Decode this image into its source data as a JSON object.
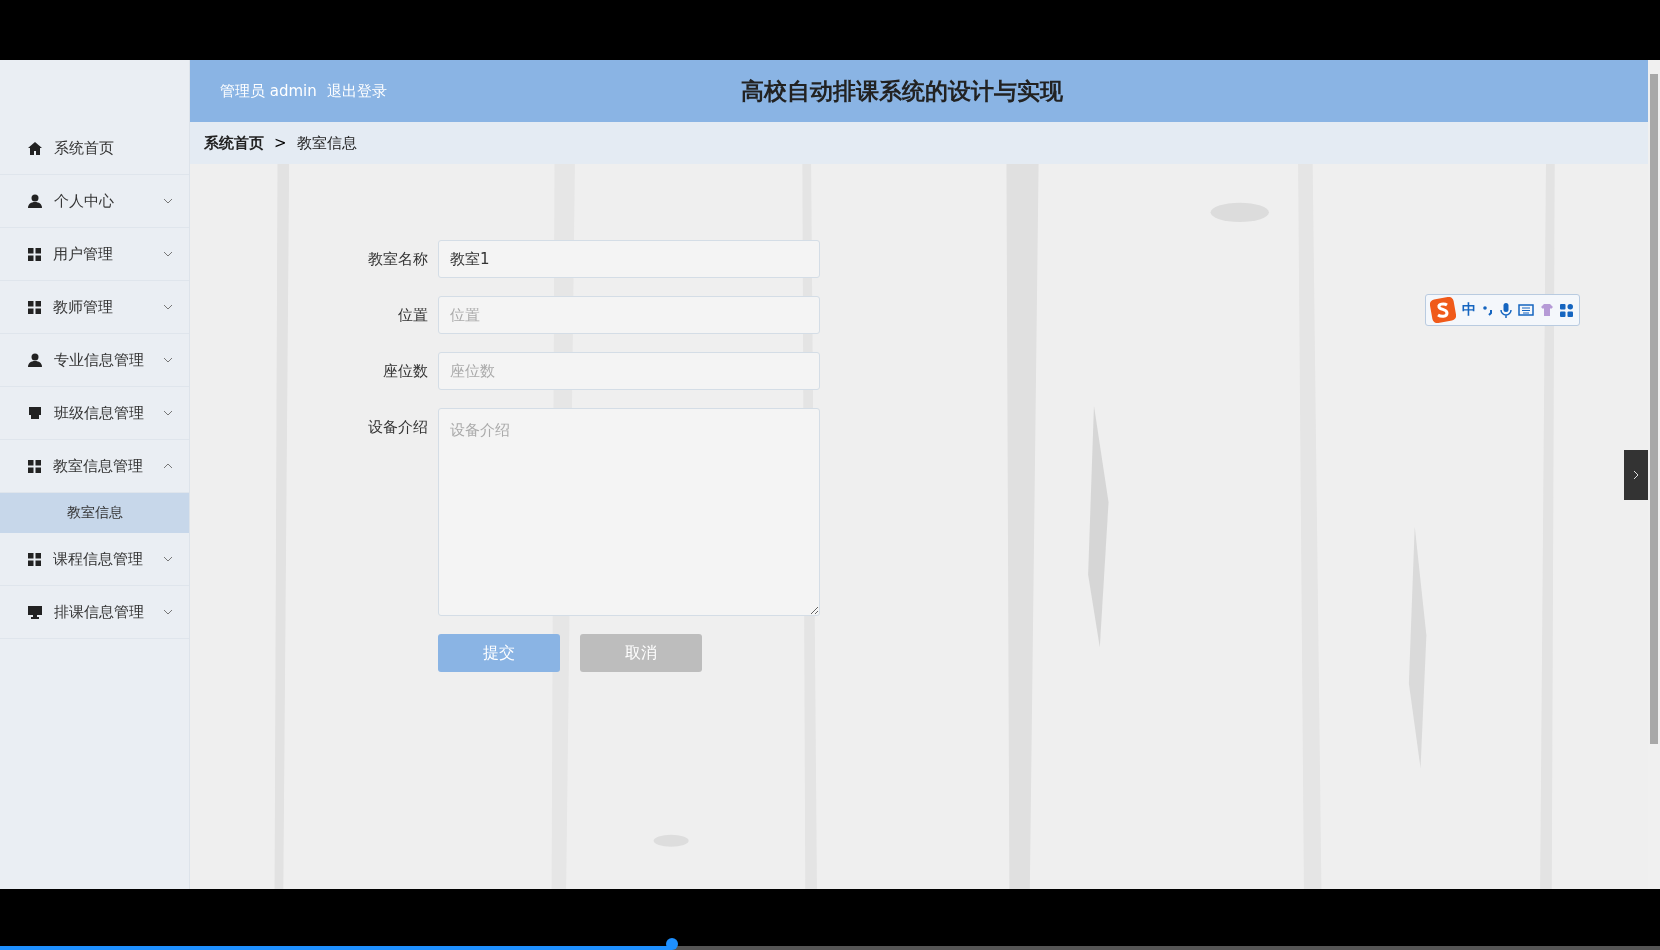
{
  "header": {
    "user_role": "管理员",
    "user_name": "admin",
    "logout": "退出登录",
    "title": "高校自动排课系统的设计与实现"
  },
  "sidebar": {
    "items": [
      {
        "label": "系统首页",
        "kind": "link"
      },
      {
        "label": "个人中心",
        "kind": "menu",
        "expanded": false
      },
      {
        "label": "用户管理",
        "kind": "menu",
        "expanded": false
      },
      {
        "label": "教师管理",
        "kind": "menu",
        "expanded": false
      },
      {
        "label": "专业信息管理",
        "kind": "menu",
        "expanded": false
      },
      {
        "label": "班级信息管理",
        "kind": "menu",
        "expanded": false
      },
      {
        "label": "教室信息管理",
        "kind": "menu",
        "expanded": true,
        "children": [
          {
            "label": "教室信息",
            "selected": true
          }
        ]
      },
      {
        "label": "课程信息管理",
        "kind": "menu",
        "expanded": false
      },
      {
        "label": "排课信息管理",
        "kind": "menu",
        "expanded": false
      }
    ]
  },
  "breadcrumb": [
    {
      "label": "系统首页",
      "current": false
    },
    {
      "label": "教室信息",
      "current": true
    }
  ],
  "breadcrumb_separator": ">",
  "form": {
    "fields": [
      {
        "label": "教室名称",
        "kind": "input",
        "value": "教室1"
      },
      {
        "label": "位置",
        "kind": "input",
        "placeholder": "位置"
      },
      {
        "label": "座位数",
        "kind": "input",
        "placeholder": "座位数"
      },
      {
        "label": "设备介绍",
        "kind": "textarea",
        "placeholder": "设备介绍"
      }
    ],
    "buttons": [
      {
        "label": "提交",
        "kind": "primary"
      },
      {
        "label": "取消",
        "kind": "secondary"
      }
    ]
  },
  "ime_toolbar": {
    "mode": "中"
  },
  "video_progress": {
    "level": 0.405
  }
}
